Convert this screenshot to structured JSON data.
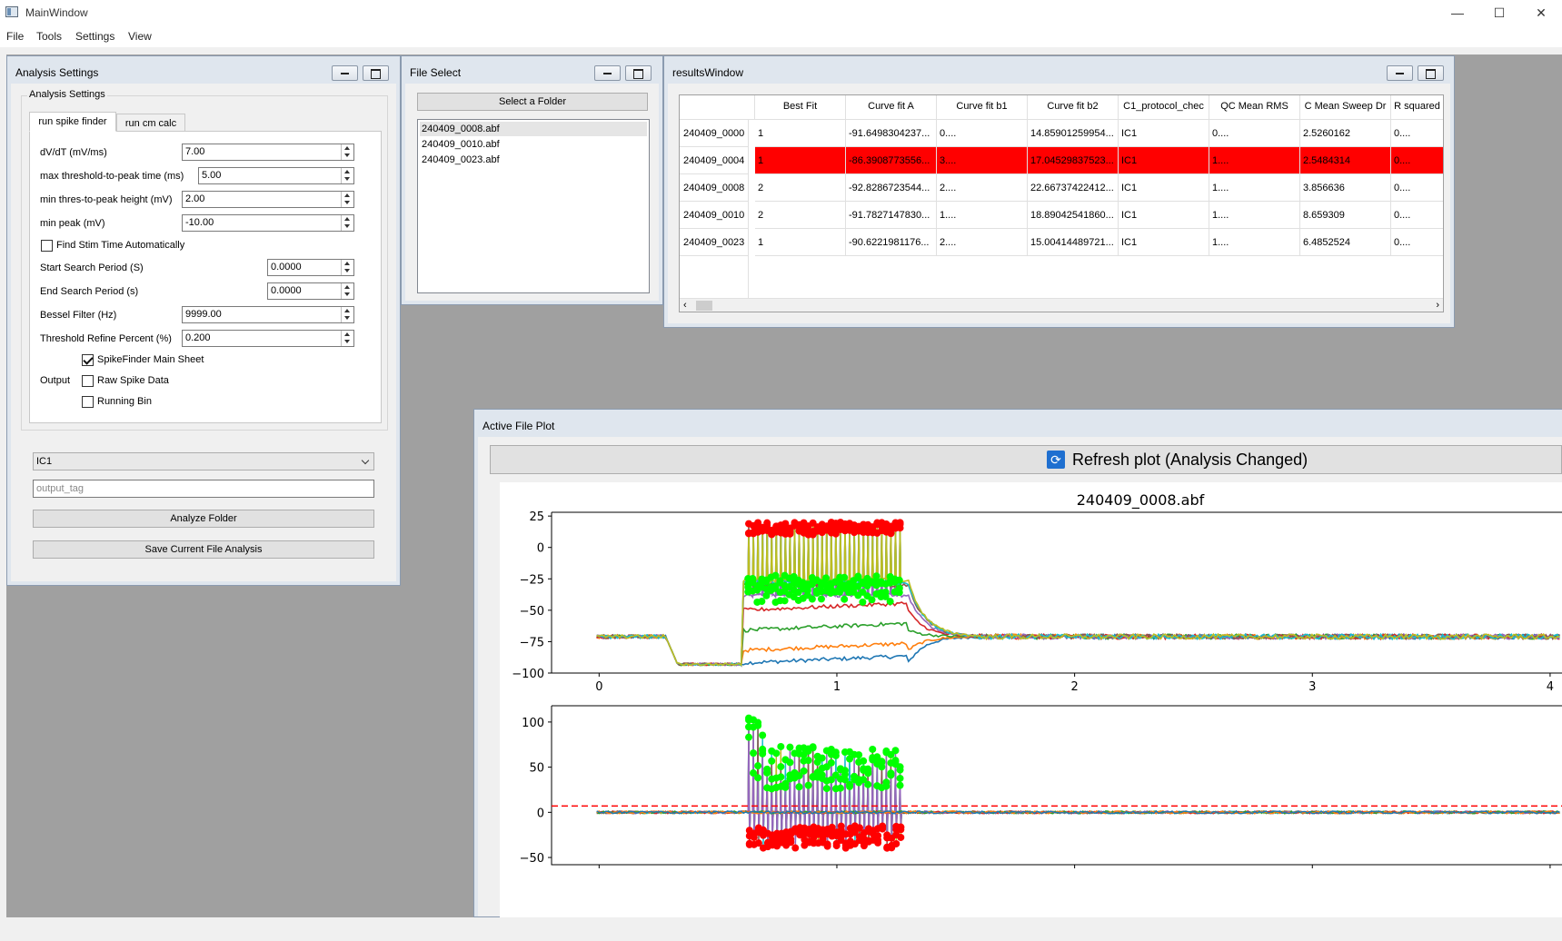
{
  "window": {
    "title": "MainWindow",
    "minimize": "—",
    "maximize": "☐",
    "close": "✕"
  },
  "menu": [
    "File",
    "Tools",
    "Settings",
    "View"
  ],
  "analysis_settings": {
    "window_title": "Analysis Settings",
    "group_title": "Analysis Settings",
    "tabs": [
      "run spike finder",
      "run cm calc"
    ],
    "fields": [
      {
        "label": "dV/dT (mV/ms)",
        "value": "7.00"
      },
      {
        "label": "max threshold-to-peak time (ms)",
        "value": "5.00"
      },
      {
        "label": "min thres-to-peak height (mV)",
        "value": "2.00"
      },
      {
        "label": "min peak (mV)",
        "value": "-10.00"
      }
    ],
    "find_stim_label": "Find Stim Time Automatically",
    "find_stim_checked": false,
    "start_search": {
      "label": "Start Search Period (S)",
      "value": "0.0000"
    },
    "end_search": {
      "label": "End Search Period (s)",
      "value": "0.0000"
    },
    "bessel": {
      "label": "Bessel Filter (Hz)",
      "value": "9999.00"
    },
    "threshold_refine": {
      "label": "Threshold Refine Percent (%)",
      "value": "0.200"
    },
    "output_label": "Output",
    "outputs": [
      {
        "label": "SpikeFinder Main Sheet",
        "checked": true
      },
      {
        "label": "Raw Spike Data",
        "checked": false
      },
      {
        "label": "Running Bin",
        "checked": false
      }
    ],
    "protocol_select": "IC1",
    "output_tag_placeholder": "output_tag",
    "analyze_button": "Analyze Folder",
    "save_button": "Save Current File Analysis"
  },
  "file_select": {
    "window_title": "File Select",
    "select_button": "Select a Folder",
    "files": [
      "240409_0008.abf",
      "240409_0010.abf",
      "240409_0023.abf"
    ],
    "selected_index": 0
  },
  "results": {
    "window_title": "resultsWindow",
    "columns": [
      "Best Fit",
      "Curve fit A",
      "Curve fit b1",
      "Curve fit b2",
      "C1_protocol_chec",
      "QC Mean RMS",
      "C Mean Sweep Dr",
      "R squared"
    ],
    "rows": [
      {
        "id": "240409_0000",
        "cells": [
          "1",
          "-91.6498304237...",
          "0....",
          "14.85901259954...",
          "IC1",
          "0....",
          "2.5260162",
          "0...."
        ],
        "highlight": false
      },
      {
        "id": "240409_0004",
        "cells": [
          "1",
          "-86.3908773556...",
          "3....",
          "17.04529837523...",
          "IC1",
          "1....",
          "2.5484314",
          "0...."
        ],
        "highlight": true
      },
      {
        "id": "240409_0008",
        "cells": [
          "2",
          "-92.8286723544...",
          "2....",
          "22.66737422412...",
          "IC1",
          "1....",
          "3.856636",
          "0...."
        ],
        "highlight": false
      },
      {
        "id": "240409_0010",
        "cells": [
          "2",
          "-91.7827147830...",
          "1....",
          "18.89042541860...",
          "IC1",
          "1....",
          "8.659309",
          "0...."
        ],
        "highlight": false
      },
      {
        "id": "240409_0023",
        "cells": [
          "1",
          "-90.6221981176...",
          "2....",
          "15.00414489721...",
          "IC1",
          "1....",
          "6.4852524",
          "0...."
        ],
        "highlight": false
      }
    ],
    "highlight_color": "#ff0000"
  },
  "active_plot": {
    "window_title": "Active File Plot",
    "refresh_label": "Refresh plot (Analysis Changed)",
    "refresh_icon": "refresh-icon"
  },
  "chart_data": [
    {
      "type": "line",
      "title": "240409_0008.abf",
      "xlabel": "",
      "ylabel": "",
      "xlim": [
        -0.2,
        4.05
      ],
      "ylim": [
        -100,
        28
      ],
      "xticks": [
        "0",
        "1",
        "2",
        "3",
        "4"
      ],
      "yticks": [
        "25",
        "0",
        "−25",
        "−50",
        "−75",
        "−100"
      ],
      "stim_window": [
        0.6,
        1.3
      ],
      "baseline_mv": -71,
      "pre_pulse_mv": -93,
      "series": [
        {
          "color": "#1f77b4",
          "pulse_mv": -92
        },
        {
          "color": "#ff7f0e",
          "pulse_mv": -82
        },
        {
          "color": "#2ca02c",
          "pulse_mv": -66
        },
        {
          "color": "#d62728",
          "pulse_mv": -50
        },
        {
          "color": "#9467bd",
          "pulse_mv": -38
        },
        {
          "color": "#8c564b",
          "pulse_mv": -30
        },
        {
          "color": "#17becf",
          "pulse_mv": -28
        },
        {
          "color": "#bcbd22",
          "pulse_mv": -26
        }
      ],
      "peak_marker_color": "#ff0000",
      "threshold_marker_color": "#00ff00"
    },
    {
      "type": "line",
      "title": "",
      "xlabel": "",
      "ylabel": "",
      "xlim": [
        -0.2,
        4.05
      ],
      "ylim": [
        -58,
        118
      ],
      "yticks": [
        "100",
        "50",
        "0",
        "−50"
      ],
      "threshold_line": 7,
      "threshold_line_color": "#ff0000",
      "stim_window": [
        0.6,
        1.3
      ],
      "peak_marker_color": "#00ff00",
      "trough_marker_color": "#ff0000"
    }
  ]
}
